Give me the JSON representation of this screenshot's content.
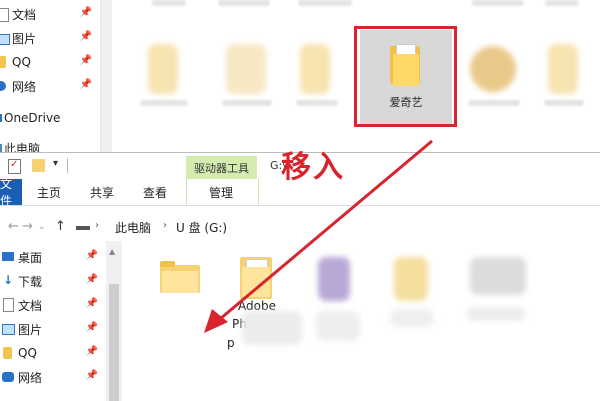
{
  "top_window": {
    "sidebar_items": [
      {
        "label": "文档",
        "icon": "document-icon",
        "pinned": true
      },
      {
        "label": "图片",
        "icon": "picture-icon",
        "pinned": true
      },
      {
        "label": "QQ",
        "icon": "folder-icon",
        "pinned": true
      },
      {
        "label": "网络",
        "icon": "network-icon",
        "pinned": true
      },
      {
        "label": "OneDrive",
        "icon": "onedrive-icon",
        "pinned": false
      },
      {
        "label": "此电脑",
        "icon": "this-pc-icon",
        "pinned": false
      }
    ],
    "highlighted_folder_label": "爱奇艺"
  },
  "annotation": {
    "move_in_label": "移入",
    "color": "#d9232d"
  },
  "bottom_window": {
    "title": "G:\\",
    "quick_access_icons": [
      "properties-icon",
      "new-folder-icon",
      "dropdown-icon"
    ],
    "context_tab_group": "驱动器工具",
    "ribbon_tabs": [
      "文件",
      "主页",
      "共享",
      "查看",
      "管理"
    ],
    "breadcrumb": [
      "此电脑",
      "U 盘 (G:)"
    ],
    "sidebar_items": [
      {
        "label": "桌面",
        "icon": "desktop-icon",
        "pinned": true
      },
      {
        "label": "下载",
        "icon": "download-icon",
        "pinned": true
      },
      {
        "label": "文档",
        "icon": "document-icon",
        "pinned": true
      },
      {
        "label": "图片",
        "icon": "picture-icon",
        "pinned": true
      },
      {
        "label": "QQ",
        "icon": "folder-icon",
        "pinned": true
      },
      {
        "label": "网络",
        "icon": "network-icon",
        "pinned": true
      }
    ],
    "file_label_lines": [
      "Adobe",
      "Ph",
      "p"
    ]
  },
  "colors": {
    "highlight_red": "#d9232d",
    "drive_tools_green": "#d5ecb1",
    "file_tab_blue": "#1a5fb4"
  }
}
